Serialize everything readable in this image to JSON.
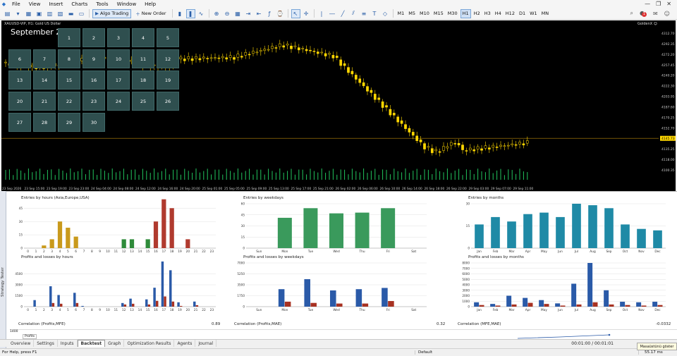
{
  "menu": {
    "items": [
      "File",
      "View",
      "Insert",
      "Charts",
      "Tools",
      "Window",
      "Help"
    ]
  },
  "toolbar": {
    "algo_label": "Algo Trading",
    "new_order_label": "New Order",
    "timeframes": [
      "M1",
      "M5",
      "M10",
      "M15",
      "M30",
      "H1",
      "H2",
      "H3",
      "H4",
      "H12",
      "D1",
      "W1",
      "MN"
    ],
    "selected_timeframe": "H1",
    "notifications_count": "1"
  },
  "chart": {
    "symbol_title": "XAUUSD-VIP, H1:  Gold US Dollar",
    "badge": "GoldenX",
    "price_levels": [
      "4312.70",
      "4292.35",
      "4272.20",
      "4257.45",
      "4240.20",
      "4222.30",
      "4203.95",
      "4187.60",
      "4170.25",
      "4152.70",
      "4145.73",
      "4135.25",
      "4118.00",
      "4100.35"
    ],
    "current_price": "4145.73",
    "time_labels": [
      "23 Sep 2026",
      "23 Sep 15:00",
      "23 Sep 19:00",
      "23 Sep 23:00",
      "24 Sep 04:00",
      "24 Sep 08:00",
      "24 Sep 12:00",
      "24 Sep 16:00",
      "24 Sep 20:00",
      "25 Sep 01:00",
      "25 Sep 05:00",
      "25 Sep 09:00",
      "25 Sep 13:00",
      "25 Sep 17:00",
      "25 Sep 21:00",
      "26 Sep 02:00",
      "26 Sep 06:00",
      "26 Sep 10:00",
      "26 Sep 14:00",
      "26 Sep 18:00",
      "26 Sep 22:00",
      "29 Sep 03:00",
      "29 Sep 07:00",
      "29 Sep 11:00"
    ],
    "colors": {
      "candle": "#ffd700",
      "volume": "#22c55e",
      "price_line": "#b8860b"
    }
  },
  "calendar": {
    "title": "September 2026",
    "days": [
      "1",
      "2",
      "3",
      "4",
      "5",
      "6",
      "7",
      "8",
      "9",
      "10",
      "11",
      "12",
      "13",
      "14",
      "15",
      "16",
      "17",
      "18",
      "19",
      "20",
      "21",
      "22",
      "23",
      "24",
      "25",
      "26",
      "27",
      "28",
      "29",
      "30"
    ]
  },
  "tester": {
    "strip_label": "Strategy Tester",
    "correlations": [
      {
        "label": "Correlation (Profits,MFE)",
        "value": "0.89"
      },
      {
        "label": "Correlation (Profits,MAE)",
        "value": "0.32"
      },
      {
        "label": "Correlation (MFE,MAE)",
        "value": "-0.0332"
      }
    ],
    "profits_label": "Profits",
    "profits_tick": "1400",
    "tabs": [
      "Overview",
      "Settings",
      "Inputs",
      "Backtest",
      "Graph",
      "Optimization Results",
      "Agents",
      "Journal"
    ],
    "selected_tab": "Backtest",
    "timer": "00:01:00 / 00:01:01"
  },
  "status": {
    "help": "For Help, press F1",
    "profile": "Default",
    "ping": "55.17 ms",
    "toast": "Masaüstünü göster"
  },
  "chart_data": [
    {
      "type": "bar",
      "title": "Entries by hours (Asia,Europe,USA)",
      "categories": [
        "0",
        "1",
        "2",
        "3",
        "4",
        "5",
        "6",
        "7",
        "8",
        "9",
        "10",
        "11",
        "12",
        "13",
        "14",
        "15",
        "16",
        "17",
        "18",
        "19",
        "20",
        "21",
        "22",
        "23"
      ],
      "values": [
        0,
        0,
        3,
        10,
        30,
        23,
        13,
        0,
        0,
        0,
        0,
        0,
        10,
        10,
        0,
        10,
        30,
        55,
        45,
        0,
        10,
        0,
        0,
        0
      ],
      "ylim": [
        0,
        50
      ],
      "yticks": [
        0,
        15,
        30,
        45
      ],
      "colors": [
        "#c99a1c",
        "#c99a1c",
        "#c99a1c",
        "#c99a1c",
        "#c99a1c",
        "#c99a1c",
        "#c99a1c",
        "#c99a1c",
        "#c99a1c",
        "#2e8b3a",
        "#2e8b3a",
        "#2e8b3a",
        "#2e8b3a",
        "#2e8b3a",
        "#2e8b3a",
        "#2e8b3a",
        "#b03a2e",
        "#b03a2e",
        "#b03a2e",
        "#b03a2e",
        "#b03a2e",
        "#b03a2e",
        "#b03a2e",
        "#b03a2e"
      ]
    },
    {
      "type": "bar",
      "title": "Entries by weekdays",
      "categories": [
        "Sun",
        "Mon",
        "Tue",
        "Wed",
        "Thu",
        "Fri",
        "Sat"
      ],
      "values": [
        0,
        41,
        54,
        47,
        48,
        54,
        0
      ],
      "ylim": [
        0,
        60
      ],
      "yticks": [
        0,
        15,
        30,
        45,
        60
      ],
      "colors": [
        "#3a9a5c"
      ]
    },
    {
      "type": "bar",
      "title": "Entries by months",
      "categories": [
        "Jan",
        "Feb",
        "Mar",
        "Apr",
        "May",
        "Jun",
        "Jul",
        "Aug",
        "Sep",
        "Oct",
        "Nov",
        "Dec"
      ],
      "values": [
        16,
        21,
        18,
        23,
        24,
        21,
        30,
        29,
        27,
        16,
        13,
        12
      ],
      "ylim": [
        0,
        30
      ],
      "yticks": [
        0,
        15,
        30
      ],
      "colors": [
        "#1f8aa6"
      ]
    },
    {
      "type": "bar",
      "title": "Profits and losses by hours",
      "categories": [
        "0",
        "1",
        "2",
        "3",
        "4",
        "5",
        "6",
        "7",
        "8",
        "9",
        "10",
        "11",
        "12",
        "13",
        "14",
        "15",
        "16",
        "17",
        "18",
        "19",
        "20",
        "21",
        "22",
        "23"
      ],
      "series": [
        {
          "name": "Profits",
          "values": [
            0,
            900,
            0,
            2800,
            1600,
            0,
            1900,
            100,
            0,
            0,
            0,
            0,
            500,
            1100,
            0,
            1000,
            2600,
            6200,
            5000,
            600,
            0,
            700,
            0,
            0
          ]
        },
        {
          "name": "Losses",
          "values": [
            0,
            0,
            0,
            500,
            400,
            0,
            500,
            0,
            0,
            0,
            0,
            0,
            300,
            400,
            0,
            300,
            800,
            1400,
            700,
            100,
            0,
            200,
            0,
            0
          ]
        }
      ],
      "ylim": [
        0,
        6000
      ],
      "yticks": [
        0,
        1500,
        3000,
        4500
      ],
      "colors": [
        "#2a5aa8",
        "#a83222"
      ]
    },
    {
      "type": "bar",
      "title": "Profits and losses by weekdays",
      "categories": [
        "Sun",
        "Mon",
        "Tue",
        "Wed",
        "Thu",
        "Fri",
        "Sat"
      ],
      "series": [
        {
          "name": "Profits",
          "values": [
            0,
            2800,
            4400,
            2600,
            2800,
            3000,
            0
          ]
        },
        {
          "name": "Losses",
          "values": [
            0,
            800,
            600,
            500,
            500,
            900,
            0
          ]
        }
      ],
      "ylim": [
        0,
        7000
      ],
      "yticks": [
        0,
        1750,
        3500,
        5250,
        7000
      ],
      "colors": [
        "#2a5aa8",
        "#a83222"
      ]
    },
    {
      "type": "bar",
      "title": "Profits and losses by months",
      "categories": [
        "Jan",
        "Feb",
        "Mar",
        "Apr",
        "May",
        "Jun",
        "Jul",
        "Aug",
        "Sep",
        "Oct",
        "Nov",
        "Dec"
      ],
      "series": [
        {
          "name": "Profits",
          "values": [
            800,
            500,
            2000,
            1600,
            1200,
            600,
            4200,
            8000,
            3000,
            900,
            800,
            900
          ]
        },
        {
          "name": "Losses",
          "values": [
            300,
            200,
            400,
            700,
            500,
            200,
            400,
            800,
            400,
            300,
            200,
            300
          ]
        }
      ],
      "ylim": [
        0,
        8000
      ],
      "yticks": [
        0,
        1000,
        2000,
        3000,
        4000,
        5000,
        6000,
        7000,
        8000
      ],
      "colors": [
        "#2a5aa8",
        "#a83222"
      ]
    }
  ]
}
